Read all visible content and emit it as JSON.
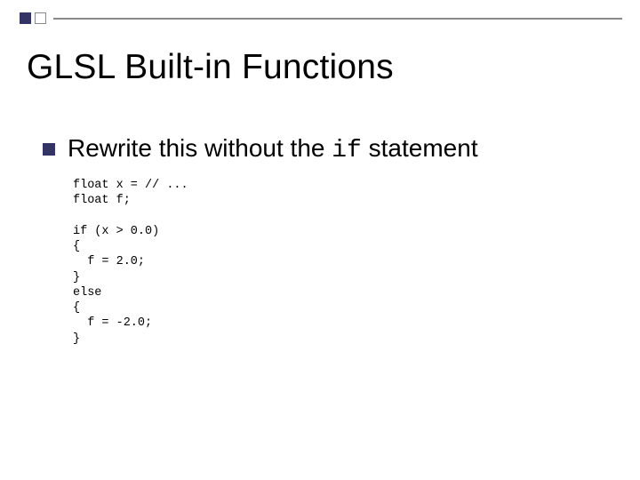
{
  "title": "GLSL Built-in Functions",
  "bullet": {
    "prefix": "Rewrite this without the ",
    "code": "if",
    "suffix": " statement"
  },
  "code": "float x = // ...\nfloat f;\n\nif (x > 0.0)\n{\n  f = 2.0;\n}\nelse\n{\n  f = -2.0;\n}"
}
